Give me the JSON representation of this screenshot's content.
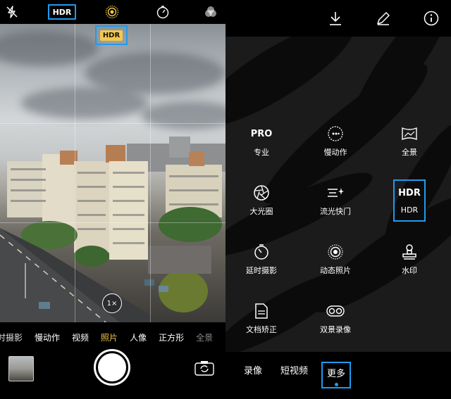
{
  "camera": {
    "top_bar": {
      "flash_icon": "flash-off-icon",
      "hdr_label": "HDR",
      "live_icon": "live-photo-icon",
      "timer_icon": "timer-icon",
      "filter_icon": "filter-icon"
    },
    "viewfinder": {
      "hdr_badge": "HDR",
      "zoom_label": "1×"
    },
    "modes": [
      "时摄影",
      "慢动作",
      "视频",
      "照片",
      "人像",
      "正方形",
      "全景"
    ],
    "active_mode": "照片",
    "buttons": {
      "thumbnail_icon": "gallery-thumbnail",
      "shutter_icon": "shutter-button",
      "switch_icon": "camera-switch-icon"
    }
  },
  "more_menu": {
    "top_icons": [
      "download-icon",
      "edit-icon",
      "info-icon"
    ],
    "items": [
      {
        "icon_text": "PRO",
        "icon": "pro-text-icon",
        "label": "专业"
      },
      {
        "icon_text": "",
        "icon": "slow-motion-icon",
        "label": "慢动作"
      },
      {
        "icon_text": "",
        "icon": "panorama-icon",
        "label": "全景"
      },
      {
        "icon_text": "",
        "icon": "aperture-icon",
        "label": "大光圈"
      },
      {
        "icon_text": "",
        "icon": "light-painting-icon",
        "label": "流光快门"
      },
      {
        "icon_text": "HDR",
        "icon": "hdr-text-icon",
        "label": "HDR"
      },
      {
        "icon_text": "",
        "icon": "timelapse-icon",
        "label": "延时摄影"
      },
      {
        "icon_text": "",
        "icon": "moving-picture-icon",
        "label": "动态照片"
      },
      {
        "icon_text": "",
        "icon": "watermark-icon",
        "label": "水印"
      },
      {
        "icon_text": "",
        "icon": "document-icon",
        "label": "文档矫正"
      },
      {
        "icon_text": "",
        "icon": "dual-view-icon",
        "label": "双景录像"
      }
    ],
    "bottom_tabs": [
      {
        "label": "录像"
      },
      {
        "label": "短视频"
      },
      {
        "label": "更多"
      }
    ],
    "accent_color": "#1e9bf0",
    "active_mode_color": "#f2c94c"
  }
}
